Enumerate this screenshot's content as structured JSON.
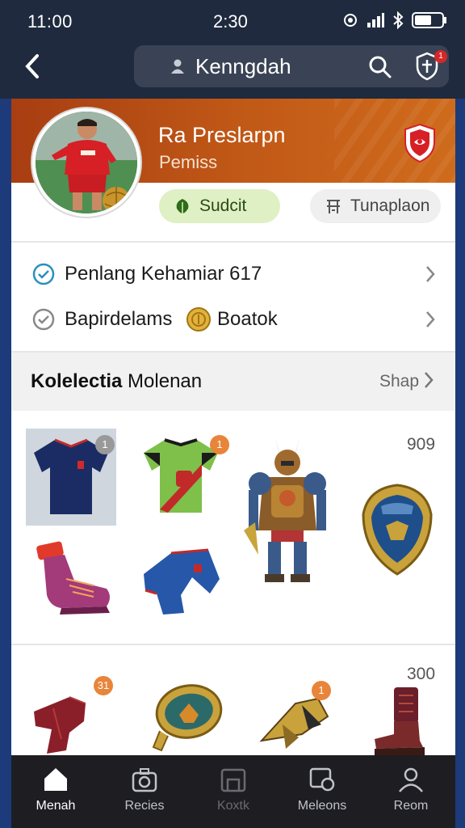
{
  "status_bar": {
    "time_left": "11:00",
    "time_center": "2:30"
  },
  "nav": {
    "search_text": "Kenngdah",
    "notification_count": "1"
  },
  "profile": {
    "name": "Ra Preslarpn",
    "subtitle": "Pemiss",
    "primary_action": "Sudcit",
    "secondary_action": "Tunaplaon"
  },
  "list_rows": [
    {
      "label": "Penlang Kehamiar 617"
    },
    {
      "label": "Bapirdelams",
      "extra": "Boatok"
    }
  ],
  "collection": {
    "title_bold": "Kolelectia",
    "title_rest": " Molenan",
    "link": "Shap",
    "count_1": "909",
    "count_2": "300",
    "item_badges": [
      "1",
      "1",
      "31",
      "1"
    ]
  },
  "tabs": [
    {
      "label": "Menah"
    },
    {
      "label": "Recies"
    },
    {
      "label": "Koxtk"
    },
    {
      "label": "Meleons"
    },
    {
      "label": "Reom"
    }
  ],
  "colors": {
    "banner": "#c25a17",
    "nav_bg": "#1f2a3e",
    "pill_green": "#dff0c4",
    "tabbar": "#1e1e22"
  }
}
